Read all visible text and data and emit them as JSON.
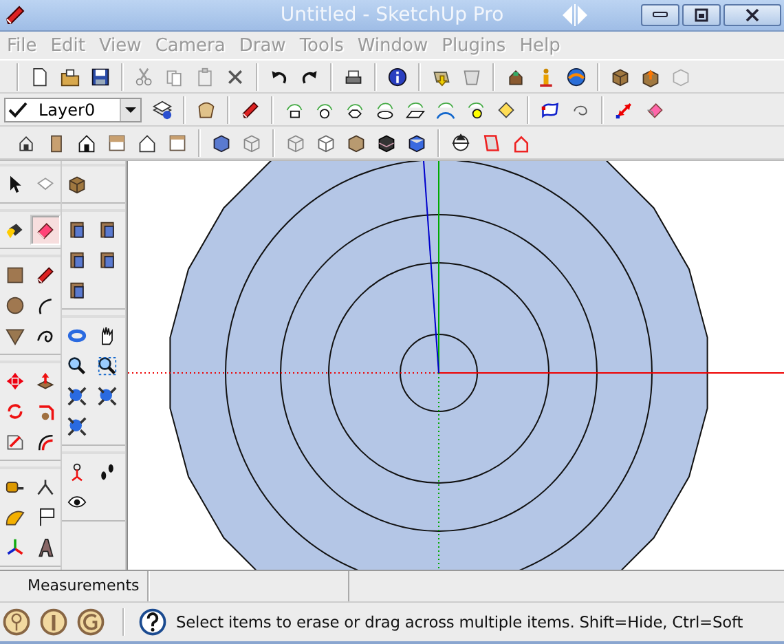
{
  "window": {
    "title": "Untitled - SketchUp Pro"
  },
  "menu": [
    {
      "label": "File",
      "disabled": true
    },
    {
      "label": "Edit",
      "disabled": true
    },
    {
      "label": "View",
      "disabled": true
    },
    {
      "label": "Camera",
      "disabled": true
    },
    {
      "label": "Draw",
      "disabled": true
    },
    {
      "label": "Tools",
      "disabled": true
    },
    {
      "label": "Window",
      "disabled": true
    },
    {
      "label": "Plugins",
      "disabled": true
    },
    {
      "label": "Help",
      "disabled": true
    }
  ],
  "layer_dropdown": {
    "value": "Layer0"
  },
  "tool_palette": {
    "tools": [
      {
        "selected": false
      },
      {
        "selected": false
      },
      {
        "selected": false
      },
      {
        "selected": true
      },
      {
        "selected": false
      },
      {
        "selected": false
      },
      {
        "selected": false
      },
      {
        "selected": false
      },
      {
        "selected": false
      },
      {
        "selected": false
      },
      {
        "selected": false
      },
      {
        "selected": false
      },
      {
        "selected": false
      },
      {
        "selected": false
      },
      {
        "selected": false
      },
      {
        "selected": false
      },
      {
        "selected": false
      },
      {
        "selected": false
      },
      {
        "selected": false
      },
      {
        "selected": false
      },
      {
        "selected": false
      },
      {
        "selected": false
      }
    ]
  },
  "measurements": {
    "label": "Measurements"
  },
  "status_bar": {
    "hint": "Select items to erase or drag across multiple items. Shift=Hide, Ctrl=Soft"
  }
}
